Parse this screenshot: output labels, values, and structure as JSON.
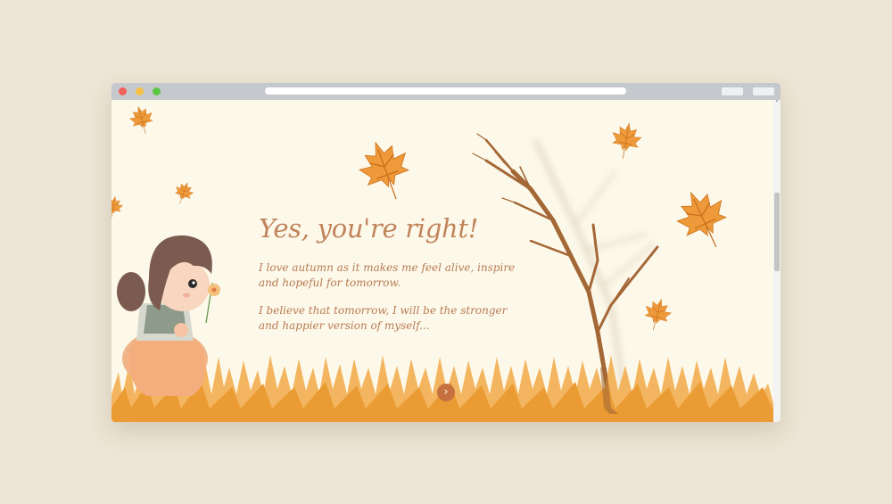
{
  "hero": {
    "heading": "Yes, you're right!",
    "paragraph_1": "I love autumn as it makes me feel alive, inspire and hopeful for tomorrow.",
    "paragraph_2": "I believe that tomorrow, I will be the stronger and happier version of myself..."
  },
  "navigation": {
    "next_icon": "chevron-right-icon",
    "next_glyph": "›"
  },
  "scrollbar": {
    "up_glyph": "˄"
  },
  "colors": {
    "page_background": "#fdf9ea",
    "outer_background": "#ede5d5",
    "heading": "#c1835a",
    "body_text": "#b87a52",
    "next_button": "#c5703e",
    "grass": "#f1a946",
    "leaf": "#ee9a3a"
  }
}
